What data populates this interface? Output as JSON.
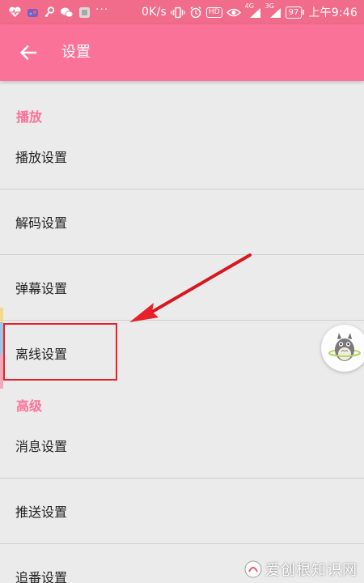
{
  "status_bar": {
    "left_icons": [
      "heart-pulse-icon",
      "bilibili-icon",
      "key-icon",
      "wechat-icon",
      "app-icon"
    ],
    "dots": "···",
    "net_speed": "0K/s",
    "right_icons": [
      "vibrate-icon",
      "alarm-icon",
      "hd-icon",
      "eye-icon",
      "signal-4g-icon",
      "signal-3g-icon"
    ],
    "hd_badge": "HD",
    "signal_4g_label": "4G",
    "signal_3g_label": "3G",
    "battery": "97",
    "time": "上午9:46",
    "colors": {
      "background": "#f06c8a",
      "text": "#ffffff"
    }
  },
  "app_bar": {
    "title": "设置",
    "back_icon": "arrow-left-icon",
    "colors": {
      "background": "#fb7299",
      "text": "#ffffff"
    }
  },
  "sections": [
    {
      "header": "播放",
      "items": [
        {
          "label": "播放设置"
        },
        {
          "label": "解码设置"
        },
        {
          "label": "弹幕设置"
        },
        {
          "label": "离线设置"
        }
      ]
    },
    {
      "header": "高级",
      "items": [
        {
          "label": "消息设置"
        },
        {
          "label": "推送设置"
        },
        {
          "label": "追番设置"
        }
      ]
    }
  ],
  "annotation": {
    "highlighted_item": "离线设置",
    "color": "#e8202a",
    "arrow_icon": "red-arrow-icon"
  },
  "floating_ball": {
    "icon": "totoro-avatar-icon"
  },
  "watermark": {
    "text": "爱创根知识网",
    "icon": "watermark-logo-icon"
  },
  "colors": {
    "accent": "#fb7299",
    "page_background": "#ebebeb",
    "divider": "#cfcfcf"
  }
}
